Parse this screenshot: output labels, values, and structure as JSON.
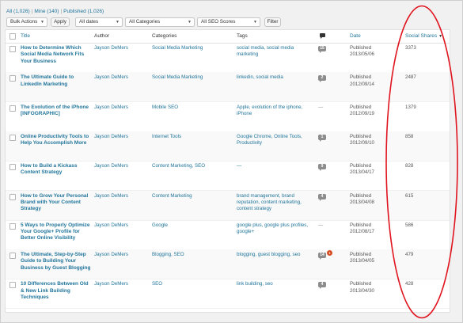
{
  "views": {
    "all_label": "All",
    "all_count": "(1,026)",
    "mine_label": "Mine",
    "mine_count": "(140)",
    "published_label": "Published",
    "published_count": "(1,026)",
    "separator": "|"
  },
  "toolbar": {
    "bulk_actions": "Bulk Actions",
    "apply": "Apply",
    "all_dates": "All dates",
    "all_categories": "All Categories",
    "all_seo_scores": "All SEO Scores",
    "filter": "Filter"
  },
  "columns": {
    "title": "Title",
    "author": "Author",
    "categories": "Categories",
    "tags": "Tags",
    "date": "Date",
    "social_shares": "Social Shares",
    "sort_indicator": "▼"
  },
  "rows": [
    {
      "title": [
        "How to Determine Which",
        "Social Media Network Fits",
        "Your Business"
      ],
      "author": "Jayson DeMers",
      "categories": [
        "Social Media Marketing"
      ],
      "tags": [
        "social media, social media marketing"
      ],
      "comments": "15",
      "pending": "",
      "status": "Published",
      "date": "2013/05/06",
      "shares": "3373"
    },
    {
      "title": [
        "The Ultimate Guide to",
        "LinkedIn Marketing"
      ],
      "author": "Jayson DeMers",
      "categories": [
        "Social Media Marketing"
      ],
      "tags": [
        "linkedin, social media"
      ],
      "comments": "2",
      "pending": "",
      "status": "Published",
      "date": "2012/09/14",
      "shares": "2487"
    },
    {
      "title": [
        "The Evolution of the iPhone",
        "[INFOGRAPHIC]"
      ],
      "author": "Jayson DeMers",
      "categories": [
        "Mobile SEO"
      ],
      "tags": [
        "Apple, evolution of the iphone,",
        "iPhone"
      ],
      "comments": "",
      "pending": "",
      "status": "Published",
      "date": "2012/09/19",
      "shares": "1379"
    },
    {
      "title": [
        "Online Productivity Tools to",
        "Help You Accomplish More"
      ],
      "author": "Jayson DeMers",
      "categories": [
        "Internet Tools"
      ],
      "tags": [
        "Google Chrome, Online Tools,",
        "Productivity"
      ],
      "comments": "1",
      "pending": "",
      "status": "Published",
      "date": "2012/09/10",
      "shares": "858"
    },
    {
      "title": [
        "How to Build a Kickass",
        "Content Strategy"
      ],
      "author": "Jayson DeMers",
      "categories": [
        "Content Marketing, SEO"
      ],
      "tags": [
        "—"
      ],
      "comments": "9",
      "pending": "",
      "status": "Published",
      "date": "2013/04/17",
      "shares": "828"
    },
    {
      "title": [
        "How to Grow Your Personal",
        "Brand with Your Content",
        "Strategy"
      ],
      "author": "Jayson DeMers",
      "categories": [
        "Content Marketing"
      ],
      "tags": [
        "brand management, brand",
        "reputation, content marketing,",
        "content strategy"
      ],
      "comments": "4",
      "pending": "",
      "status": "Published",
      "date": "2013/04/08",
      "shares": "615"
    },
    {
      "title": [
        "5 Ways to Properly Optimize",
        "Your Google+ Profile for",
        "Better Online Visibility"
      ],
      "author": "Jayson DeMers",
      "categories": [
        "Google"
      ],
      "tags": [
        "google plus, google plus profiles,",
        "google+"
      ],
      "comments": "",
      "pending": "",
      "status": "Published",
      "date": "2012/08/17",
      "shares": "586"
    },
    {
      "title": [
        "The Ultimate, Step-by-Step",
        "Guide to Building Your",
        "Business by Guest Blogging"
      ],
      "author": "Jayson DeMers",
      "categories": [
        "Blogging, SEO"
      ],
      "tags": [
        "blogging, guest blogging, seo"
      ],
      "comments": "14",
      "pending": "1",
      "status": "Published",
      "date": "2013/04/05",
      "shares": "479"
    },
    {
      "title": [
        "10 Differences Between Old",
        "& New Link Building",
        "Techniques"
      ],
      "author": "Jayson DeMers",
      "categories": [
        "SEO"
      ],
      "tags": [
        "link building, seo"
      ],
      "comments": "4",
      "pending": "",
      "status": "Published",
      "date": "2013/04/30",
      "shares": "428"
    }
  ],
  "no_comments_mark": "—",
  "icons": {
    "comments_header": "speech-bubble-icon",
    "dropdown": "chevron-down-icon"
  },
  "colors": {
    "link": "#21759b",
    "highlight_oval": "#e0141e",
    "pending_badge": "#d54e21"
  }
}
